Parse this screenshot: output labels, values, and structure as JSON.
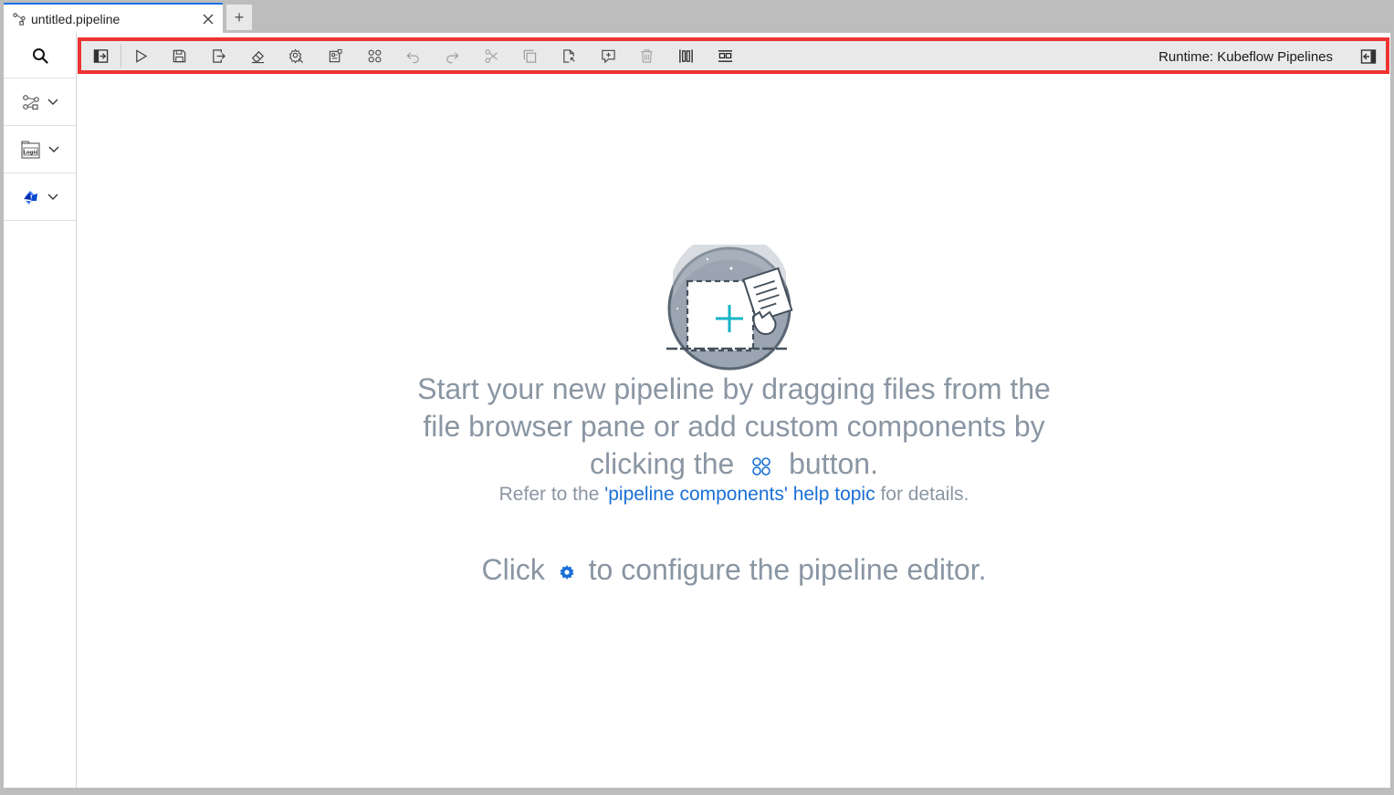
{
  "tab": {
    "title": "untitled.pipeline",
    "add_label": "+"
  },
  "toolbar": {
    "buttons": [
      "open-panel",
      "run-pipeline",
      "save-pipeline",
      "export-pipeline",
      "clear-pipeline",
      "pipeline-properties",
      "open-runtimes",
      "open-component-catalogs",
      "undo",
      "redo",
      "cut",
      "copy",
      "paste",
      "add-comment",
      "delete",
      "arrange-horizontally",
      "arrange-vertically"
    ],
    "runtime_label": "Runtime: Kubeflow Pipelines"
  },
  "palette": {
    "items": [
      "generic-components",
      "logic-components",
      "kubeflow-components"
    ]
  },
  "empty_state": {
    "line1": "Start your new pipeline by dragging files from the",
    "line2": "file browser pane or add custom components by",
    "line3_before": "clicking the",
    "line3_after": "button.",
    "help_before": "Refer to the",
    "help_link": "'pipeline components' help topic",
    "help_after": "for details.",
    "config_before": "Click",
    "config_after": "to configure the pipeline editor."
  },
  "colors": {
    "accent": "#1a6fd6",
    "highlight_border": "#ee3333",
    "text_muted": "#8a96a3"
  }
}
